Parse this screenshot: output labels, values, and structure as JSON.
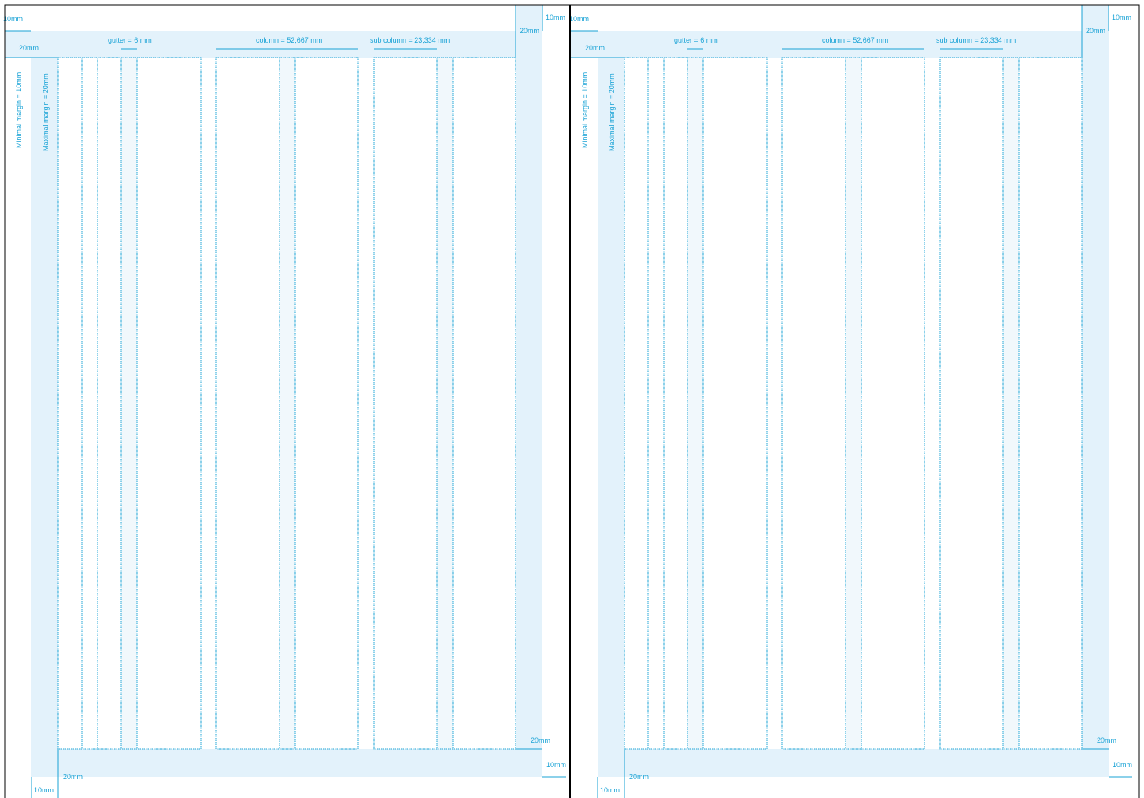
{
  "colors": {
    "guide_line": "#1aa3d6",
    "margin_fill": "#e3f2fb",
    "page_border": "#000000"
  },
  "pages": [
    {
      "label_top_min": "10mm",
      "label_top_max": "20mm",
      "label_right_min": "10mm",
      "label_right_max": "20mm",
      "label_right_bottom": "20mm",
      "label_right_bottom_min": "10mm",
      "label_bottom_max": "20mm",
      "label_bottom_min": "10mm",
      "label_gutter": "gutter = 6 mm",
      "label_column": "column = 52,667 mm",
      "label_sub_column": "sub column = 23,334 mm",
      "label_minimal_margin": "Minimal margin = 10mm",
      "label_maximal_margin": "Maximal margin = 20mm"
    },
    {
      "label_top_min": "10mm",
      "label_top_max": "20mm",
      "label_right_min": "10mm",
      "label_right_max": "20mm",
      "label_right_bottom": "20mm",
      "label_right_bottom_min": "10mm",
      "label_bottom_max": "20mm",
      "label_bottom_min": "10mm",
      "label_gutter": "gutter = 6 mm",
      "label_column": "column = 52,667 mm",
      "label_sub_column": "sub column = 23,334 mm",
      "label_minimal_margin": "Minimal margin = 10mm",
      "label_maximal_margin": "Maximal margin = 20mm"
    }
  ]
}
